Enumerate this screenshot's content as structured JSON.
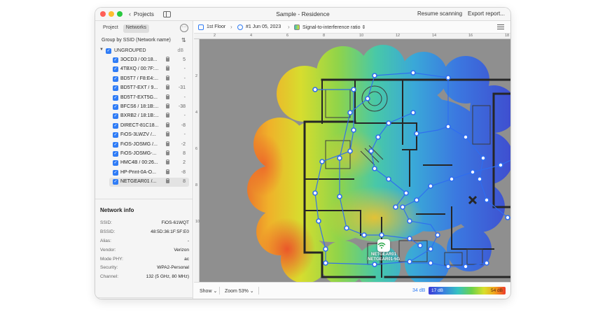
{
  "window": {
    "title": "Sample - Residence",
    "back_label": "Projects",
    "actions": [
      "Resume scanning",
      "Export report..."
    ]
  },
  "sidebar": {
    "tabs": [
      {
        "label": "Project",
        "active": false
      },
      {
        "label": "Networks",
        "active": true
      }
    ],
    "group_by": "Group by SSID (Network name)",
    "group": {
      "name": "UNGROUPED",
      "unit": "dB"
    },
    "networks": [
      {
        "name": "3OCD3 / 00:18...",
        "value": "5",
        "selected": false
      },
      {
        "name": "4TBXQ / 00:7F:...",
        "value": "-",
        "selected": false
      },
      {
        "name": "BD5T7 / F8:E4:...",
        "value": "-",
        "selected": false
      },
      {
        "name": "BD5T7-EXT / 9...",
        "value": "-31",
        "selected": false
      },
      {
        "name": "BD5T7-EXT5G...",
        "value": "-",
        "selected": false
      },
      {
        "name": "BFCS6 / 18:1B:...",
        "value": "-38",
        "selected": false
      },
      {
        "name": "BXRB2 / 18:1B:...",
        "value": "-",
        "selected": false
      },
      {
        "name": "DIRECT-81C18...",
        "value": "-8",
        "selected": false
      },
      {
        "name": "FiOS-3LWZV /...",
        "value": "-",
        "selected": false
      },
      {
        "name": "FiOS-JOSMG /...",
        "value": "-2",
        "selected": false
      },
      {
        "name": "FiOS-JOSMG-...",
        "value": "8",
        "selected": false
      },
      {
        "name": "HMC4B / 00:26...",
        "value": "2",
        "selected": false
      },
      {
        "name": "HP-Print-0A-O...",
        "value": "-8",
        "selected": false
      },
      {
        "name": "NETGEAR01 /...",
        "value": "8",
        "selected": true
      }
    ],
    "info_title": "Network info",
    "info": [
      {
        "key": "SSID:",
        "value": "FiOS-61WQT"
      },
      {
        "key": "BSSID:",
        "value": "48:5D:36:1F:5F:E0"
      },
      {
        "key": "Alias:",
        "value": "-"
      },
      {
        "key": "Vendor:",
        "value": "Verizon"
      },
      {
        "key": "Mode PHY:",
        "value": "ac"
      },
      {
        "key": "Security:",
        "value": "WPA2-Personal"
      },
      {
        "key": "Channel:",
        "value": "132 (5 GHz, 80 MHz)"
      }
    ]
  },
  "breadcrumb": {
    "floor": "1st Floor",
    "scan": "#1 Jun 05, 2023",
    "visualization": "Signal-to-interference ratio"
  },
  "ruler": {
    "top": [
      "2",
      "4",
      "6",
      "8",
      "10",
      "12",
      "14",
      "16",
      "18"
    ],
    "left": [
      "2",
      "4",
      "6",
      "8",
      "10"
    ]
  },
  "access_point": {
    "label_line1": "NETGEAR01",
    "label_line2": "NETGEAR01-5G"
  },
  "bottom": {
    "show_label": "Show",
    "zoom_label": "Zoom 53%",
    "legend_current": "34 dB",
    "legend_min": "17 dB",
    "legend_max": "54 dB"
  },
  "colors": {
    "accent": "#2f7cf6",
    "wall": "#2a2a2a",
    "scan_point": "#2f6df0"
  }
}
